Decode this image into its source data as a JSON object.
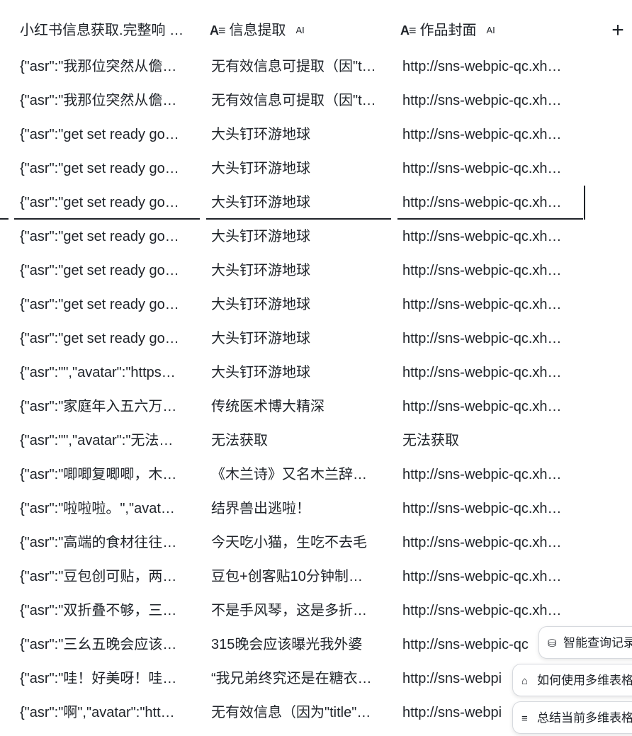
{
  "table": {
    "headers": {
      "col1_label": "小红书信息获取.完整响",
      "col2_label": "信息提取",
      "col2_ai": "AI",
      "col3_label": "作品封面",
      "col3_ai": "AI",
      "add_column": "+"
    },
    "rows": [
      {
        "c1": "{\"asr\":\"我那位突然从儋",
        "c2": "无有效信息可提取（因\"t",
        "c3": "http://sns-webpic-qc.xh",
        "c2e": true,
        "c3e": true
      },
      {
        "c1": "{\"asr\":\"我那位突然从儋",
        "c2": "无有效信息可提取（因\"t",
        "c3": "http://sns-webpic-qc.xh",
        "c2e": true,
        "c3e": true
      },
      {
        "c1": "{\"asr\":\"get set ready go",
        "c2": "大头钉环游地球",
        "c3": "http://sns-webpic-qc.xh",
        "c2e": false,
        "c3e": true
      },
      {
        "c1": "{\"asr\":\"get set ready go",
        "c2": "大头钉环游地球",
        "c3": "http://sns-webpic-qc.xh",
        "c2e": false,
        "c3e": true
      },
      {
        "c1": "{\"asr\":\"get set ready go",
        "c2": "大头钉环游地球",
        "c3": "http://sns-webpic-qc.xh",
        "c2e": false,
        "c3e": true
      },
      {
        "c1": "{\"asr\":\"get set ready go",
        "c2": "大头钉环游地球",
        "c3": "http://sns-webpic-qc.xh",
        "c2e": false,
        "c3e": true
      },
      {
        "c1": "{\"asr\":\"get set ready go",
        "c2": "大头钉环游地球",
        "c3": "http://sns-webpic-qc.xh",
        "c2e": false,
        "c3e": true
      },
      {
        "c1": "{\"asr\":\"get set ready go",
        "c2": "大头钉环游地球",
        "c3": "http://sns-webpic-qc.xh",
        "c2e": false,
        "c3e": true
      },
      {
        "c1": "{\"asr\":\"get set ready go",
        "c2": "大头钉环游地球",
        "c3": "http://sns-webpic-qc.xh",
        "c2e": false,
        "c3e": true
      },
      {
        "c1": "{\"asr\":\"\",\"avatar\":\"https",
        "c2": "大头钉环游地球",
        "c3": "http://sns-webpic-qc.xh",
        "c2e": false,
        "c3e": true
      },
      {
        "c1": "{\"asr\":\"家庭年入五六万",
        "c2": "传统医术博大精深",
        "c3": "http://sns-webpic-qc.xh",
        "c2e": false,
        "c3e": true
      },
      {
        "c1": "{\"asr\":\"\",\"avatar\":\"无法",
        "c2": "无法获取",
        "c3": "无法获取",
        "c2e": false,
        "c3e": false
      },
      {
        "c1": "{\"asr\":\"唧唧复唧唧，木",
        "c2": "《木兰诗》又名木兰辞",
        "c3": "http://sns-webpic-qc.xh",
        "c2e": true,
        "c3e": true
      },
      {
        "c1": "{\"asr\":\"啦啦啦。\",\"avat",
        "c2": "结界兽出逃啦！",
        "c3": "http://sns-webpic-qc.xh",
        "c2e": false,
        "c3e": true
      },
      {
        "c1": "{\"asr\":\"高端的食材往往",
        "c2": "今天吃小猫，生吃不去毛",
        "c3": "http://sns-webpic-qc.xh",
        "c2e": false,
        "c3e": true
      },
      {
        "c1": "{\"asr\":\"豆包创可贴，两",
        "c2": "豆包+创客贴10分钟制",
        "c3": "http://sns-webpic-qc.xh",
        "c2e": true,
        "c3e": true
      },
      {
        "c1": "{\"asr\":\"双折叠不够，三",
        "c2": "不是手风琴，这是多折",
        "c3": "http://sns-webpic-qc.xh",
        "c2e": true,
        "c3e": true
      },
      {
        "c1": "{\"asr\":\"三幺五晚会应该",
        "c2": "315晚会应该曝光我外婆",
        "c3": "http://sns-webpic-qc",
        "c2e": false,
        "c3e": false
      },
      {
        "c1": "{\"asr\":\"哇！好美呀！哇",
        "c2": "“我兄弟终究还是在糖衣",
        "c3": "http://sns-webpi",
        "c2e": true,
        "c3e": false
      },
      {
        "c1": "{\"asr\":\"啊\",\"avatar\":\"htt",
        "c2": "无有效信息（因为\"title\"",
        "c3": "http://sns-webpi",
        "c2e": true,
        "c3e": false
      }
    ]
  },
  "suggestions": [
    {
      "label": "智能查询记录",
      "icon": "database-icon"
    },
    {
      "label": "如何使用多维表格",
      "icon": "graduation-cap-icon"
    },
    {
      "label": "总结当前多维表格",
      "icon": "summary-list-icon"
    }
  ]
}
